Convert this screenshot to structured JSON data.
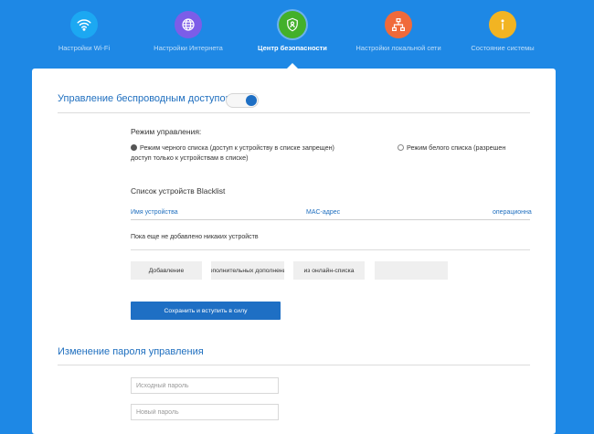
{
  "nav": {
    "items": [
      {
        "label": "Настройки Wi-Fi",
        "icon": "wifi-icon",
        "color": "#1ca8f2"
      },
      {
        "label": "Настройки Интернета",
        "icon": "globe-icon",
        "color": "#7c5de8"
      },
      {
        "label": "Центр безопасности",
        "icon": "shield-icon",
        "color": "#43b02a",
        "active": true
      },
      {
        "label": "Настройки локальной сети",
        "icon": "network-icon",
        "color": "#f06a3a"
      },
      {
        "label": "Состояние системы",
        "icon": "info-icon",
        "color": "#f2b422"
      }
    ]
  },
  "wireless_access": {
    "title": "Управление беспроводным доступом",
    "toggle_on": true,
    "mode_label": "Режим управления:",
    "blacklist_mode_line1": "Режим черного списка (доступ к устройству в списке запрещен)",
    "blacklist_mode_line2": "доступ только к устройствам в списке)",
    "whitelist_mode": "Режим белого списка (разрешен",
    "selected_mode": "blacklist",
    "list_title": "Список устройств Blacklist",
    "columns": [
      "Имя устройства",
      "MAC-адрес",
      "операционна"
    ],
    "empty_text": "Пока еще не добавлено никаких устройств",
    "buttons": [
      "Добавление",
      "дополнительных дополнений",
      "из онлайн-списка",
      ""
    ],
    "save_label": "Сохранить и вступить в силу"
  },
  "password": {
    "title": "Изменение пароля управления",
    "old_placeholder": "Исходный пароль",
    "new_placeholder": "Новый пароль"
  },
  "colors": {
    "background": "#1e88e5",
    "accent": "#1e6fc4"
  }
}
